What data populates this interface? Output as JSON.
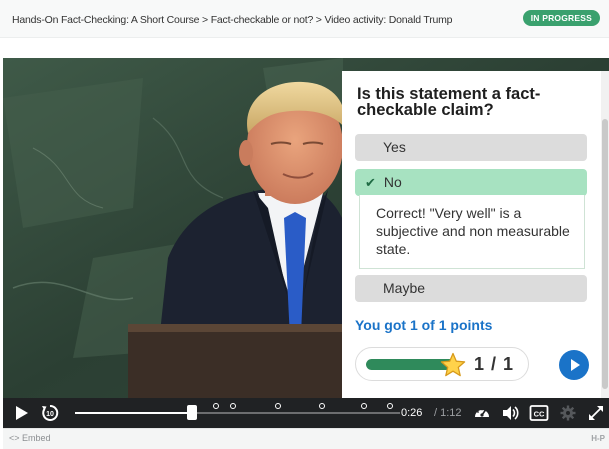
{
  "breadcrumb": "Hands-On Fact-Checking: A Short Course > Fact-checkable or not? > Video activity: Donald Trump",
  "status_badge": "IN PROGRESS",
  "quiz": {
    "question": "Is this statement a fact-checkable claim?",
    "options": [
      {
        "label": "Yes",
        "state": "default"
      },
      {
        "label": "No",
        "state": "correct-selected"
      },
      {
        "label": "Maybe",
        "state": "default"
      }
    ],
    "feedback": "Correct! \"Very well\" is a subjective and non measurable state.",
    "score_text": "You got 1 of 1 points",
    "score_fraction": "1 / 1",
    "score_progress": 1.0
  },
  "player": {
    "time_current": "0:26",
    "time_total": "/ 1:12",
    "playback_progress": 0.36,
    "cc_label": "CC"
  },
  "footer": {
    "embed_label": "<> Embed",
    "logo_text": "H-P"
  },
  "colors": {
    "accent_blue": "#1a73c8",
    "success_green": "#3aa16e",
    "correct_option_bg": "#a7e2c1",
    "player_bar": "#202224"
  }
}
